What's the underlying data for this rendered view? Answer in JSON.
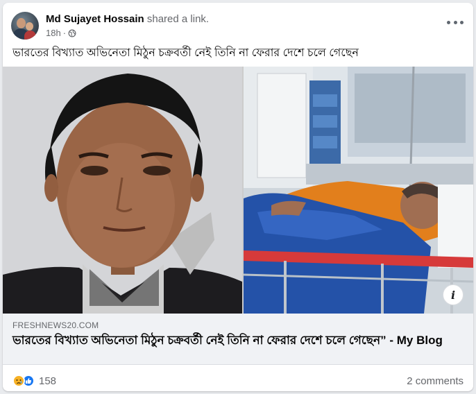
{
  "post": {
    "author": "Md Sujayet Hossain",
    "action": "shared a link.",
    "time": "18h",
    "caption": "ভারতের বিখ্যাত অভিনেতা মিঠুন চক্রবর্তী নেই তিনি না ফেরার দেশে চলে গেছেন"
  },
  "link": {
    "domain": "FRESHNEWS20.COM",
    "title": "ভারতের বিখ্যাত অভিনেতা মিঠুন চক্রবর্তী নেই তিনি না ফেরার দেশে চলে গেছেন” - My Blog"
  },
  "footer": {
    "reaction_count": "158",
    "comments": "2 comments"
  },
  "icons": {
    "more": "more-options-icon",
    "privacy": "globe-icon",
    "info": "info-icon",
    "reactions": [
      "sad-reaction-icon",
      "like-reaction-icon"
    ]
  },
  "colors": {
    "like": "#1877f2",
    "sad": "#f7b125",
    "secondary_text": "#65676b",
    "link_box": "#f0f2f5"
  }
}
